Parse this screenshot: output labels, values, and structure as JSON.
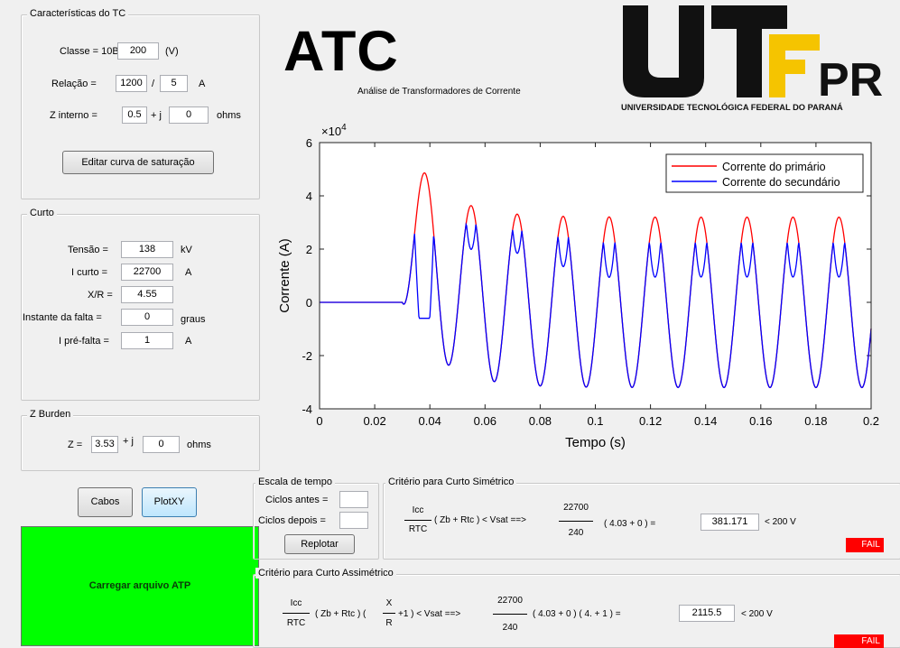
{
  "tc": {
    "title": "Características do TC",
    "classe_label": "Classe = 10B",
    "classe_value": "200",
    "classe_unit": "(V)",
    "relacao_label": "Relação =",
    "relacao_primary": "1200",
    "relacao_sep": "/",
    "relacao_secondary": "5",
    "relacao_unit": "A",
    "zint_label": "Z interno =",
    "zint_real": "0.5",
    "zint_j": "+ j",
    "zint_imag": "0",
    "zint_unit": "ohms",
    "edit_button": "Editar curva de saturação"
  },
  "curto": {
    "title": "Curto",
    "tensao_label": "Tensão =",
    "tensao_value": "138",
    "tensao_unit": "kV",
    "icurto_label": "I curto =",
    "icurto_value": "22700",
    "icurto_unit": "A",
    "xr_label": "X/R =",
    "xr_value": "4.55",
    "instante_label": "Instante da falta =",
    "instante_value": "0",
    "instante_unit": "graus",
    "iprefalta_label": "I pré-falta =",
    "iprefalta_value": "1",
    "iprefalta_unit": "A"
  },
  "burden": {
    "title": "Z Burden",
    "z_label": "Z =",
    "z_real": "3.53",
    "z_j": "+ j",
    "z_imag": "0",
    "z_unit": "ohms"
  },
  "buttons": {
    "cabos": "Cabos",
    "plotxy": "PlotXY",
    "carregar": "Carregar arquivo ATP",
    "replotar": "Replotar"
  },
  "header": {
    "app_title": "ATC",
    "subtitle": "Análise de Transformadores de Corrente",
    "logo_text": "UTFPR",
    "logo_caption": "UNIVERSIDADE TECNOLÓGICA FEDERAL DO PARANÁ"
  },
  "escala": {
    "title": "Escala de tempo",
    "antes_label": "Ciclos antes =",
    "antes_value": "",
    "depois_label": "Ciclos depois =",
    "depois_value": ""
  },
  "simetrico": {
    "title": "Critério para Curto Simétrico",
    "icc": "Icc",
    "rtc": "RTC",
    "zb_part": "( Zb + Rtc ) < Vsat ==>",
    "num": "22700",
    "den": "240",
    "sum_part": "( 4.03 +     0     ) =",
    "result": "381.171",
    "limit": "< 200  V",
    "status": "FAIL"
  },
  "assimetrico": {
    "title": "Critério para Curto Assimétrico",
    "icc": "Icc",
    "rtc": "RTC",
    "zb_part": "( Zb + Rtc ) (",
    "x": "X",
    "r": "R",
    "plus1": "+1 )  <  Vsat ==>",
    "num": "22700",
    "den": "240",
    "sum_part": "( 4.03 +     0     ) ( 4.  + 1 ) =",
    "result": "2115.5",
    "limit": "<   200  V",
    "status": "FAIL"
  },
  "colors": {
    "primary": "#ff0000",
    "secondary": "#0000ff",
    "load_button": "#00ff00",
    "fail": "#ff0000",
    "logo_yellow": "#f5c400"
  },
  "chart_data": {
    "type": "line",
    "xlabel": "Tempo (s)",
    "ylabel": "Corrente (A)",
    "y_multiplier": "×10^4",
    "xlim": [
      0,
      0.2
    ],
    "ylim": [
      -4,
      6
    ],
    "x_ticks": [
      "0",
      "0.02",
      "0.04",
      "0.06",
      "0.08",
      "0.1",
      "0.12",
      "0.14",
      "0.16",
      "0.18",
      "0.2"
    ],
    "y_ticks": [
      "-4",
      "-2",
      "0",
      "2",
      "4",
      "6"
    ],
    "legend_position": "top-right",
    "fault_time_s": 0.03,
    "frequency_hz": 60,
    "series": [
      {
        "name": "Corrente do primário",
        "color": "#ff0000",
        "peaks_x": [
          0.036,
          0.0535,
          0.0695,
          0.0865,
          0.1035,
          0.12,
          0.137,
          0.1535,
          0.1705,
          0.187
        ],
        "peaks_y": [
          4.85,
          3.6,
          3.3,
          3.22,
          3.2,
          3.2,
          3.2,
          3.2,
          3.2,
          3.2
        ],
        "troughs_y": [
          -2.4,
          -3.0,
          -3.15,
          -3.18,
          -3.2,
          -3.2,
          -3.2,
          -3.2,
          -3.2,
          -3.2
        ]
      },
      {
        "name": "Corrente do secundário",
        "color": "#0000ff",
        "peaks_x": [
          0.0345,
          0.052,
          0.0685,
          0.0855,
          0.1025,
          0.119,
          0.136,
          0.1525,
          0.1695,
          0.186
        ],
        "peaks_y": [
          2.6,
          3.6,
          3.3,
          3.22,
          3.2,
          3.2,
          3.2,
          3.2,
          3.2,
          3.2
        ],
        "troughs_y": [
          -2.4,
          -3.0,
          -3.15,
          -3.18,
          -3.2,
          -3.2,
          -3.2,
          -3.2,
          -3.2,
          -3.2
        ]
      }
    ]
  }
}
